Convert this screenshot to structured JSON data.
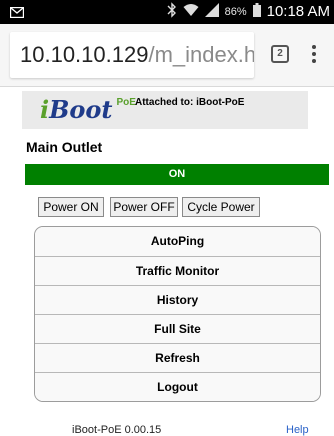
{
  "status_bar": {
    "battery": "86%",
    "time": "10:18 AM",
    "icons": [
      "email-icon",
      "bluetooth-icon",
      "wifi-icon",
      "signal-icon",
      "battery-icon"
    ]
  },
  "browser": {
    "url_host": "10.10.10.129",
    "url_path": "/m_index.htm",
    "tab_count": "2"
  },
  "header": {
    "logo_i": "i",
    "logo_boot": "Boot",
    "logo_poe": "PoE",
    "attached": "Attached to: iBoot-PoE"
  },
  "outlet": {
    "title": "Main Outlet",
    "status": "ON",
    "status_color": "#008000"
  },
  "actions": {
    "power_on": "Power ON",
    "power_off": "Power OFF",
    "cycle": "Cycle Power"
  },
  "menu": {
    "items": [
      "AutoPing",
      "Traffic Monitor",
      "History",
      "Full Site",
      "Refresh",
      "Logout"
    ]
  },
  "footer": {
    "version": "iBoot-PoE 0.00.15",
    "help": "Help"
  }
}
